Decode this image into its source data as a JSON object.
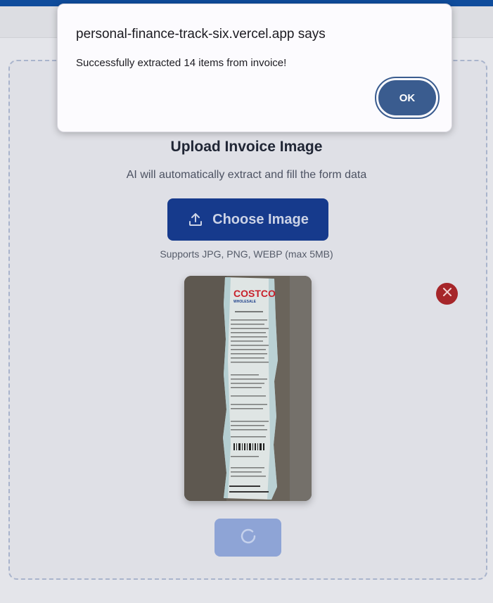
{
  "dialog": {
    "title": "personal-finance-track-six.vercel.app says",
    "message": "Successfully extracted 14 items from invoice!",
    "ok_label": "OK"
  },
  "upload": {
    "title": "Upload Invoice Image",
    "subtitle": "AI will automatically extract and fill the form data",
    "choose_label": "Choose Image",
    "supports_text": "Supports JPG, PNG, WEBP (max 5MB)"
  },
  "preview": {
    "icon": "receipt-image",
    "remove_icon": "close-icon"
  },
  "extract": {
    "state": "loading",
    "icon": "spinner-icon"
  },
  "colors": {
    "accent": "#163a8c",
    "danger": "#a6262a",
    "dialog_button": "#3a5c8f",
    "loading_button": "#8ea4d6"
  }
}
